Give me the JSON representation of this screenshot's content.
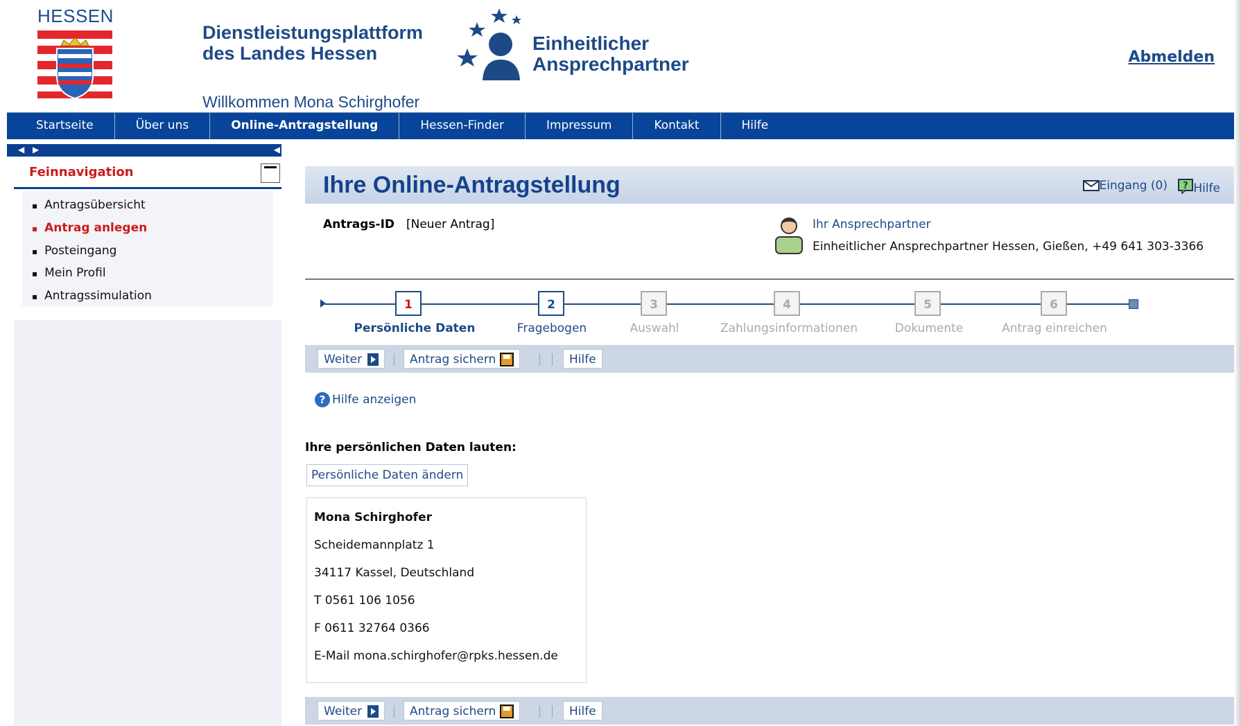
{
  "header": {
    "state_label": "HESSEN",
    "platform_title_line1": "Dienstleistungsplattform",
    "platform_title_line2": "des Landes Hessen",
    "welcome": "Willkommen Mona Schirghofer",
    "logo_text_line1": "Einheitlicher",
    "logo_text_line2": "Ansprechpartner",
    "logout_label": "Abmelden"
  },
  "nav": {
    "items": [
      {
        "label": "Startseite"
      },
      {
        "label": "Über uns"
      },
      {
        "label": "Online-Antragstellung",
        "active": true
      },
      {
        "label": "Hessen-Finder"
      },
      {
        "label": "Impressum"
      },
      {
        "label": "Kontakt"
      },
      {
        "label": "Hilfe"
      }
    ]
  },
  "sidebar": {
    "title": "Feinnavigation",
    "items": [
      {
        "label": "Antragsübersicht"
      },
      {
        "label": "Antrag anlegen",
        "active": true
      },
      {
        "label": "Posteingang"
      },
      {
        "label": "Mein Profil"
      },
      {
        "label": "Antragssimulation"
      }
    ]
  },
  "main": {
    "title": "Ihre Online-Antragstellung",
    "inbox_label": "Eingang (0)",
    "help_label": "Hilfe",
    "antrags_id_label": "Antrags-ID",
    "antrags_id_value": "[Neuer Antrag]",
    "contact_link": "Ihr Ansprechpartner",
    "contact_detail": "Einheitlicher Ansprechpartner Hessen, Gießen, +49 641 303-3366"
  },
  "steps": [
    {
      "number": "1",
      "label": "Persönliche Daten",
      "state": "current"
    },
    {
      "number": "2",
      "label": "Fragebogen",
      "state": "enabled"
    },
    {
      "number": "3",
      "label": "Auswahl",
      "state": "disabled"
    },
    {
      "number": "4",
      "label": "Zahlungsinformationen",
      "state": "disabled"
    },
    {
      "number": "5",
      "label": "Dokumente",
      "state": "disabled"
    },
    {
      "number": "6",
      "label": "Antrag einreichen",
      "state": "disabled"
    }
  ],
  "toolbar": {
    "next_label": "Weiter",
    "save_label": "Antrag sichern",
    "help_label": "Hilfe"
  },
  "content": {
    "help_show": "Hilfe anzeigen",
    "heading": "Ihre persönlichen Daten lauten:",
    "change_button": "Persönliche Daten ändern",
    "person": {
      "name": "Mona Schirghofer",
      "street": "Scheidemannplatz 1",
      "city": "34117 Kassel, Deutschland",
      "phone": "T 0561 106 1056",
      "fax": "F 0611 32764 0366",
      "email": "E-Mail mona.schirghofer@rpks.hessen.de"
    }
  },
  "colors": {
    "brand_blue": "#07449a",
    "accent_red": "#cc1a1a",
    "link_blue": "#1d4a87"
  }
}
